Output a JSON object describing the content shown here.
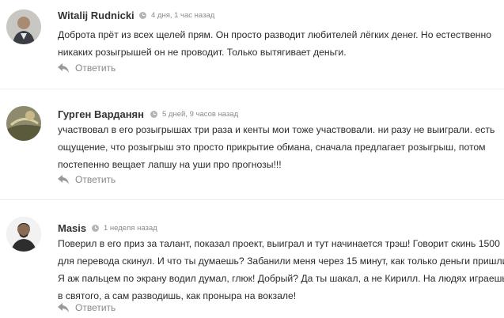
{
  "comments": [
    {
      "author": "Witalij Rudnicki",
      "time": "4 дня, 1 час назад",
      "lines": [
        "Доброта прёт из всех щелей прям. Он просто разводит любителей лёгких денег. Но естественно",
        "никаких розыгрышей он не проводит. Только вытягивает деньги."
      ],
      "reply_label": "Ответить"
    },
    {
      "author": "Гурген Варданян",
      "time": "5 дней, 9 часов назад",
      "lines": [
        "участвовал в его розыгрышах три раза и кенты мои тоже участвовали. ни разу не выиграли. есть",
        "ощущение, что розыгрыш это просто прикрытие обмана, сначала предлагает розыгрыш, потом",
        "постепенно вещает лапшу на уши про прогнозы!!!"
      ],
      "reply_label": "Ответить"
    },
    {
      "author": "Masis",
      "time": "1 неделя назад",
      "lines": [
        "Поверил в его приз за талант, показал проект, выиграл и тут начинается трэш! Говорит скинь 1500",
        "для перевода скинул. И что ты думаешь? Забанили меня через 15 минут, как только деньги пришли!",
        "Я аж пальцем по экрану водил думал, глюк! Добрый? Да ты шакал, а не Кирилл. На людях играешь",
        "в святого, а сам разводишь, как проныра на вокзале!"
      ],
      "reply_label": "Ответить"
    }
  ],
  "icons": {
    "time": "clock-icon",
    "reply": "reply-arrow-icon"
  },
  "colors": {
    "author": "#333333",
    "meta": "#8a8a8a",
    "text": "#2b2b2b",
    "reply": "#888888"
  }
}
